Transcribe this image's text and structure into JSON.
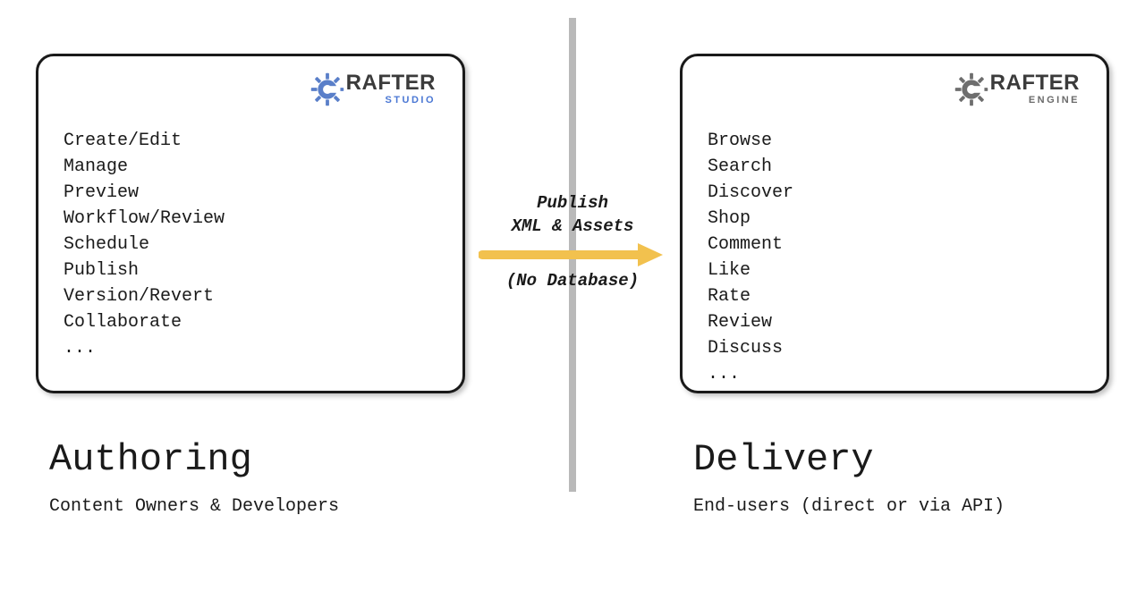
{
  "left": {
    "title": "Authoring",
    "subtitle": "Content Owners & Developers",
    "logo": {
      "brand_prefix": "C",
      "brand_rest": "RAFTER",
      "subbrand": "STUDIO"
    },
    "features": [
      "Create/Edit",
      "Manage",
      "Preview",
      "Workflow/Review",
      "Schedule",
      "Publish",
      "Version/Revert",
      "Collaborate",
      "..."
    ]
  },
  "right": {
    "title": "Delivery",
    "subtitle": "End-users (direct or via API)",
    "logo": {
      "brand_prefix": "C",
      "brand_rest": "RAFTER",
      "subbrand": "ENGINE"
    },
    "features": [
      "Browse",
      "Search",
      "Discover",
      "Shop",
      "Comment",
      "Like",
      "Rate",
      "Review",
      "Discuss",
      "..."
    ]
  },
  "flow": {
    "line1": "Publish",
    "line2": "XML & Assets",
    "line3": "(No Database)"
  },
  "colors": {
    "studio_gear": "#5a7fc9",
    "engine_gear": "#6e6e6e",
    "arrow": "#f2c14e"
  }
}
